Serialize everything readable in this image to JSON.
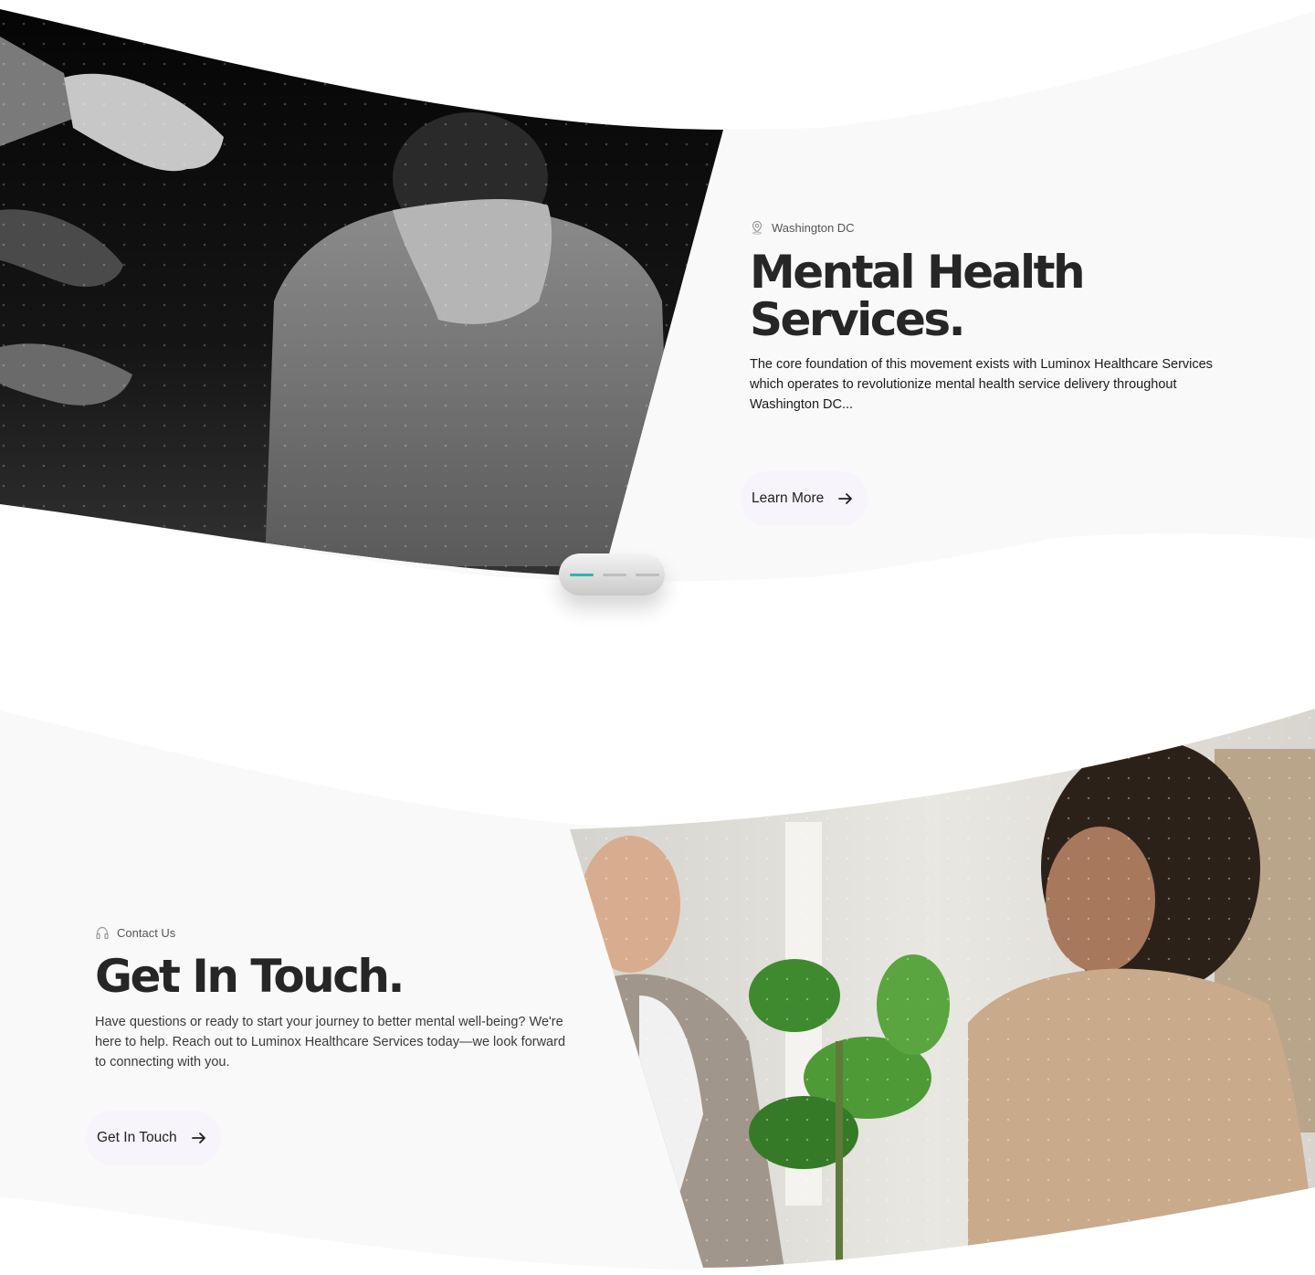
{
  "hero": {
    "location": "Washington DC",
    "title": "Mental Health Services.",
    "description": "The core foundation of this movement exists with Luminox Healthcare Services which operates to revolutionize mental health service delivery throughout Washington DC...",
    "cta_label": "Learn More",
    "image_alt": "Soldier in camouflage holding head in hands with reaching hands",
    "slider": {
      "count": 3,
      "active_index": 0,
      "active_color": "#2fb3b0"
    }
  },
  "contact": {
    "eyebrow": "Contact Us",
    "title": "Get In Touch.",
    "description": "Have questions or ready to start your journey to better mental well-being? We're here to help. Reach out to Luminox Healthcare Services today—we look forward to connecting with you.",
    "cta_label": "Get In Touch",
    "image_alt": "Counselor talking with young woman in hoodie beside a plant"
  },
  "icons": {
    "location": "location-pin-icon",
    "headphones": "headphones-icon",
    "arrow": "arrow-right-icon"
  },
  "colors": {
    "panel_bg": "#f9f9f9",
    "title": "#262626",
    "button_bg": "#f7f4fb",
    "accent": "#2fb3b0"
  }
}
